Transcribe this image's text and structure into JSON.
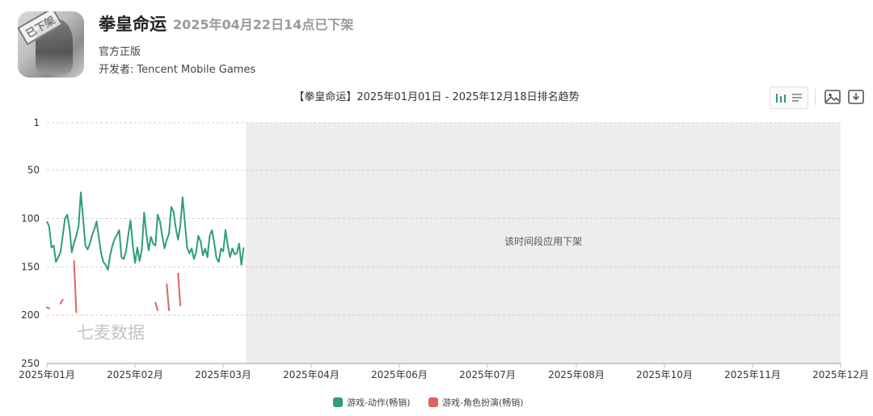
{
  "app": {
    "title": "拳皇命运",
    "removed_note": "2025年04月22日14点已下架",
    "icon_badge": "已下架",
    "edition": "官方正版",
    "developer_label": "开发者:",
    "developer_name": "Tencent Mobile Games"
  },
  "toolbar": {
    "toggle_icon": "bar-list-toggle-icon",
    "image_icon": "image-export-icon",
    "download_icon": "download-icon"
  },
  "colors": {
    "action_series": "#2e9e74",
    "rpg_series": "#e06262",
    "grid": "#cfcfcf",
    "shade": "#ededed",
    "axis": "#bdbdbd"
  },
  "chart_data": {
    "type": "line",
    "title": "【拳皇命运】2025年01月01日 - 2025年12月18日排名趋势",
    "y_axis": {
      "reversed": true,
      "ylim": [
        1,
        250
      ],
      "ticks": [
        1,
        50,
        100,
        150,
        200,
        250
      ]
    },
    "x_axis": {
      "ticks": [
        "2025年01月",
        "2025年02月",
        "2025年03月",
        "2025年04月",
        "2025年06月",
        "2025年07月",
        "2025年08月",
        "2025年10月",
        "2025年11月",
        "2025年12月"
      ],
      "xlim": [
        "2025-01-01",
        "2025-12-18"
      ]
    },
    "grid": true,
    "legend_position": "bottom-center",
    "shaded_region": {
      "start": "2025-03-30",
      "end": "2025-12-18",
      "label": "该时间段应用下架"
    },
    "watermark": "七麦数据",
    "series": [
      {
        "name": "游戏-动作(畅销)",
        "points": [
          [
            "2025-01-01",
            103
          ],
          [
            "2025-01-02",
            108
          ],
          [
            "2025-01-03",
            130
          ],
          [
            "2025-01-04",
            128
          ],
          [
            "2025-01-05",
            145
          ],
          [
            "2025-01-06",
            140
          ],
          [
            "2025-01-07",
            135
          ],
          [
            "2025-01-08",
            118
          ],
          [
            "2025-01-09",
            100
          ],
          [
            "2025-01-10",
            96
          ],
          [
            "2025-01-11",
            110
          ],
          [
            "2025-01-12",
            135
          ],
          [
            "2025-01-13",
            125
          ],
          [
            "2025-01-14",
            118
          ],
          [
            "2025-01-15",
            108
          ],
          [
            "2025-01-16",
            73
          ],
          [
            "2025-01-17",
            100
          ],
          [
            "2025-01-18",
            128
          ],
          [
            "2025-01-19",
            132
          ],
          [
            "2025-01-20",
            126
          ],
          [
            "2025-01-21",
            117
          ],
          [
            "2025-01-22",
            111
          ],
          [
            "2025-01-23",
            103
          ],
          [
            "2025-01-24",
            120
          ],
          [
            "2025-01-25",
            136
          ],
          [
            "2025-01-26",
            145
          ],
          [
            "2025-01-27",
            148
          ],
          [
            "2025-01-28",
            153
          ],
          [
            "2025-01-29",
            138
          ],
          [
            "2025-01-30",
            128
          ],
          [
            "2025-01-31",
            121
          ],
          [
            "2025-02-01",
            117
          ],
          [
            "2025-02-02",
            112
          ],
          [
            "2025-02-03",
            140
          ],
          [
            "2025-02-04",
            142
          ],
          [
            "2025-02-05",
            134
          ],
          [
            "2025-02-06",
            117
          ],
          [
            "2025-02-07",
            102
          ],
          [
            "2025-02-08",
            128
          ],
          [
            "2025-02-09",
            146
          ],
          [
            "2025-02-10",
            130
          ],
          [
            "2025-02-11",
            144
          ],
          [
            "2025-02-12",
            132
          ],
          [
            "2025-02-13",
            94
          ],
          [
            "2025-02-14",
            116
          ],
          [
            "2025-02-15",
            133
          ],
          [
            "2025-02-16",
            119
          ],
          [
            "2025-02-17",
            126
          ],
          [
            "2025-02-18",
            128
          ],
          [
            "2025-02-19",
            96
          ],
          [
            "2025-02-20",
            103
          ],
          [
            "2025-02-21",
            118
          ],
          [
            "2025-02-22",
            131
          ],
          [
            "2025-02-23",
            122
          ],
          [
            "2025-02-24",
            116
          ],
          [
            "2025-02-25",
            88
          ],
          [
            "2025-02-26",
            93
          ],
          [
            "2025-02-27",
            110
          ],
          [
            "2025-02-28",
            122
          ],
          [
            "2025-03-01",
            107
          ],
          [
            "2025-03-02",
            78
          ],
          [
            "2025-03-03",
            104
          ],
          [
            "2025-03-04",
            130
          ],
          [
            "2025-03-05",
            136
          ],
          [
            "2025-03-06",
            131
          ],
          [
            "2025-03-07",
            142
          ],
          [
            "2025-03-08",
            135
          ],
          [
            "2025-03-09",
            118
          ],
          [
            "2025-03-10",
            124
          ],
          [
            "2025-03-11",
            138
          ],
          [
            "2025-03-12",
            131
          ],
          [
            "2025-03-13",
            140
          ],
          [
            "2025-03-14",
            118
          ],
          [
            "2025-03-15",
            112
          ],
          [
            "2025-03-16",
            125
          ],
          [
            "2025-03-17",
            141
          ],
          [
            "2025-03-18",
            145
          ],
          [
            "2025-03-19",
            131
          ],
          [
            "2025-03-20",
            134
          ],
          [
            "2025-03-21",
            112
          ],
          [
            "2025-03-22",
            128
          ],
          [
            "2025-03-23",
            140
          ],
          [
            "2025-03-24",
            131
          ],
          [
            "2025-03-25",
            137
          ],
          [
            "2025-03-26",
            136
          ],
          [
            "2025-03-27",
            126
          ],
          [
            "2025-03-28",
            148
          ],
          [
            "2025-03-29",
            130
          ]
        ]
      },
      {
        "name": "游戏-角色扮演(畅销)",
        "segments": [
          [
            [
              "2025-01-01",
              192
            ],
            [
              "2025-01-02",
              193
            ]
          ],
          [
            [
              "2025-01-07",
              188
            ],
            [
              "2025-01-08",
              184
            ]
          ],
          [
            [
              "2025-01-13",
              144
            ],
            [
              "2025-01-14",
              197
            ]
          ],
          [
            [
              "2025-02-18",
              187
            ],
            [
              "2025-02-19",
              195
            ]
          ],
          [
            [
              "2025-02-23",
              168
            ],
            [
              "2025-02-24",
              195
            ]
          ],
          [
            [
              "2025-02-28",
              157
            ],
            [
              "2025-03-01",
              190
            ]
          ]
        ]
      }
    ]
  }
}
